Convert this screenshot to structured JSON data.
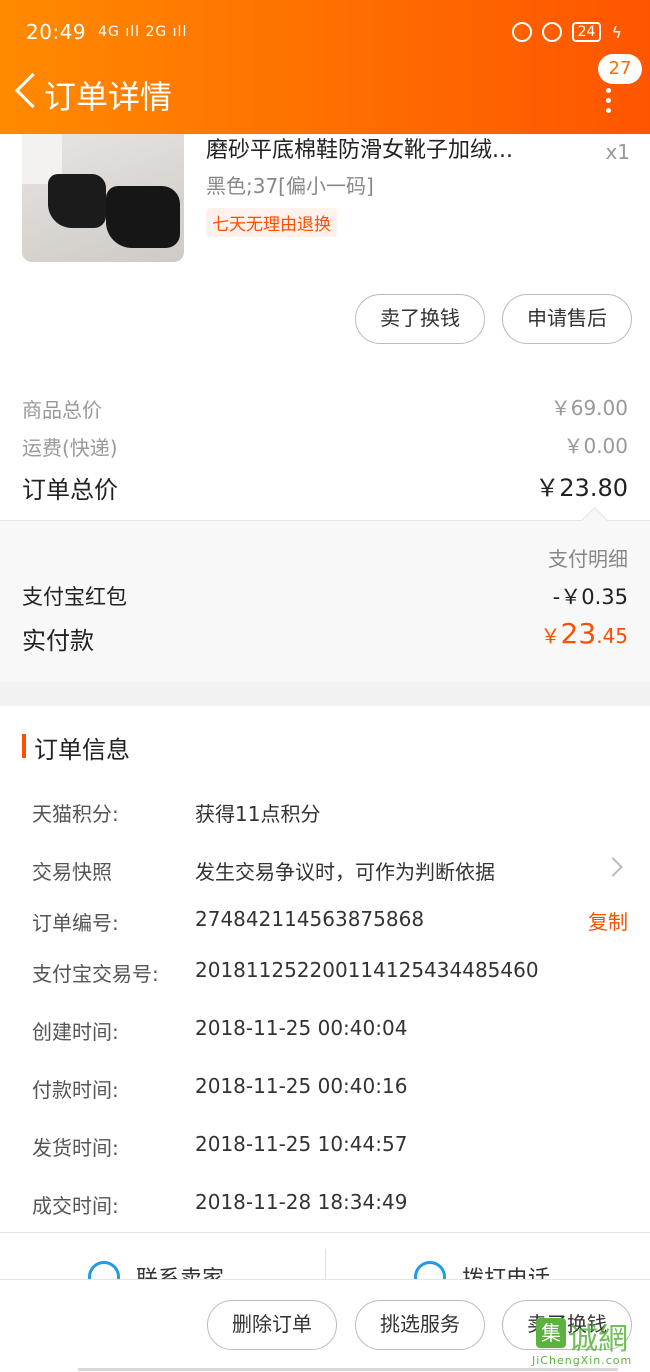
{
  "status": {
    "time": "20:49",
    "signal": "4G ıll 2G ıll",
    "battery": "24"
  },
  "header": {
    "title": "订单详情",
    "badge": "27"
  },
  "product": {
    "title": "磨砂平底棉鞋防滑女靴子加绒...",
    "qty": "x1",
    "sku": "黑色;37[偏小一码]",
    "tag": "七天无理由退换"
  },
  "product_actions": {
    "sell": "卖了换钱",
    "aftersale": "申请售后"
  },
  "price": {
    "goods_label": "商品总价",
    "goods_value": "￥69.00",
    "ship_label": "运费(快递)",
    "ship_value": "￥0.00",
    "total_label": "订单总价",
    "total_value": "￥23.80"
  },
  "payment": {
    "detail_link": "支付明细",
    "hongbao_label": "支付宝红包",
    "hongbao_value": "-￥0.35",
    "paid_label": "实付款",
    "paid_currency": "￥",
    "paid_int": "23",
    "paid_dec": ".45"
  },
  "order_info": {
    "title": "订单信息",
    "rows": [
      {
        "label": "天猫积分:",
        "value": "获得11点积分"
      },
      {
        "label": "交易快照",
        "value": "发生交易争议时，可作为判断依据"
      },
      {
        "label": "订单编号:",
        "value": "274842114563875868"
      },
      {
        "label": "支付宝交易号:",
        "value": "2018112522001141254344854​60"
      },
      {
        "label": "创建时间:",
        "value": "2018-11-25 00:40:04"
      },
      {
        "label": "付款时间:",
        "value": "2018-11-25 00:40:16"
      },
      {
        "label": "发货时间:",
        "value": "2018-11-25 10:44:57"
      },
      {
        "label": "成交时间:",
        "value": "2018-11-28 18:34:49"
      }
    ],
    "copy": "复制"
  },
  "contact": {
    "seller": "联系卖家",
    "call": "拨打电话"
  },
  "footer": {
    "delete": "删除订单",
    "services": "挑选服务",
    "sell": "卖了换钱"
  },
  "watermark": {
    "glyph": "集",
    "text": "诚網",
    "url": "JiChengXin.com"
  }
}
